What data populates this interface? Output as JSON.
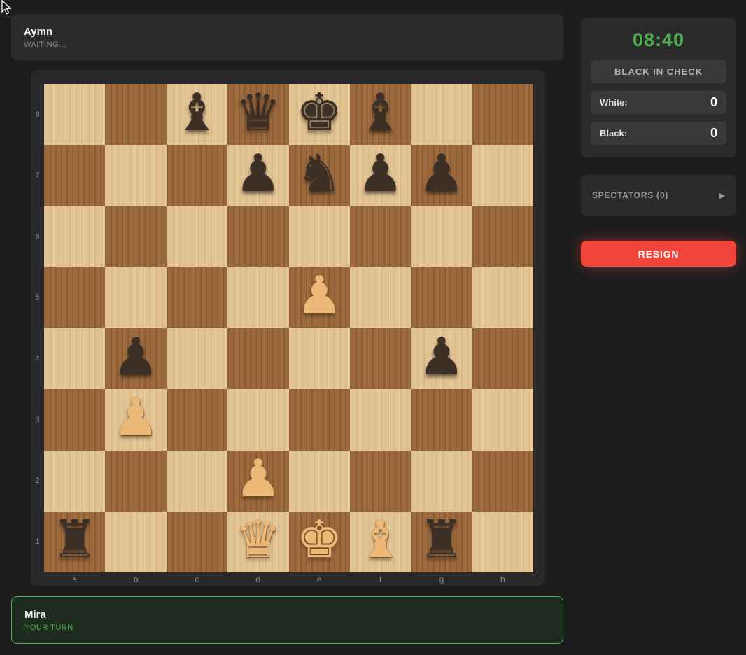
{
  "opponent": {
    "name": "Aymn",
    "status": "WAITING..."
  },
  "player": {
    "name": "Mira",
    "status": "YOUR TURN"
  },
  "sidebar": {
    "timer": "08:40",
    "check_status": "BLACK IN CHECK",
    "scores": [
      {
        "label": "White:",
        "value": "0"
      },
      {
        "label": "Black:",
        "value": "0"
      }
    ],
    "spectators_label": "SPECTATORS (0)",
    "spectators_arrow": "▶",
    "resign_label": "RESIGN"
  },
  "board": {
    "files": [
      "a",
      "b",
      "c",
      "d",
      "e",
      "f",
      "g",
      "h"
    ],
    "ranks": [
      "8",
      "7",
      "6",
      "5",
      "4",
      "3",
      "2",
      "1"
    ],
    "light_square_color": "#e2c392",
    "dark_square_color": "#9c693d",
    "pieces": [
      {
        "square": "c8",
        "color": "black",
        "type": "bishop"
      },
      {
        "square": "d8",
        "color": "black",
        "type": "queen"
      },
      {
        "square": "e8",
        "color": "black",
        "type": "king"
      },
      {
        "square": "f8",
        "color": "black",
        "type": "bishop"
      },
      {
        "square": "d7",
        "color": "black",
        "type": "pawn"
      },
      {
        "square": "e7",
        "color": "black",
        "type": "knight"
      },
      {
        "square": "f7",
        "color": "black",
        "type": "pawn"
      },
      {
        "square": "g7",
        "color": "black",
        "type": "pawn"
      },
      {
        "square": "e5",
        "color": "white",
        "type": "pawn"
      },
      {
        "square": "b4",
        "color": "black",
        "type": "pawn"
      },
      {
        "square": "g4",
        "color": "black",
        "type": "pawn"
      },
      {
        "square": "b3",
        "color": "white",
        "type": "pawn"
      },
      {
        "square": "d2",
        "color": "white",
        "type": "pawn"
      },
      {
        "square": "a1",
        "color": "black",
        "type": "rook"
      },
      {
        "square": "d1",
        "color": "white",
        "type": "queen"
      },
      {
        "square": "e1",
        "color": "white",
        "type": "king"
      },
      {
        "square": "f1",
        "color": "white",
        "type": "bishop"
      },
      {
        "square": "g1",
        "color": "black",
        "type": "rook"
      }
    ]
  }
}
